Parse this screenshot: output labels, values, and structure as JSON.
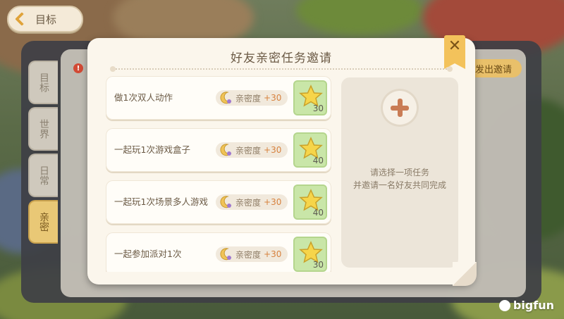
{
  "background": {
    "back_label": "目标",
    "side_tabs": [
      "目标",
      "世界",
      "日常",
      "亲密"
    ],
    "notice_badge": "!",
    "action_button": "发出邀请",
    "watermark": "bigfun"
  },
  "dialog": {
    "title": "好友亲密任务邀请",
    "close_icon": "close-icon",
    "tasks": [
      {
        "name": "做1次双人动作",
        "intimacy_label": "亲密度",
        "intimacy_value": "+30",
        "reward_icon": "star-icon",
        "reward_count": "30"
      },
      {
        "name": "一起玩1次游戏盒子",
        "intimacy_label": "亲密度",
        "intimacy_value": "+30",
        "reward_icon": "star-icon",
        "reward_count": "40"
      },
      {
        "name": "一起玩1次场景多人游戏",
        "intimacy_label": "亲密度",
        "intimacy_value": "+30",
        "reward_icon": "star-icon",
        "reward_count": "40"
      },
      {
        "name": "一起参加派对1次",
        "intimacy_label": "亲密度",
        "intimacy_value": "+30",
        "reward_icon": "star-icon",
        "reward_count": "30"
      }
    ],
    "slot": {
      "icon": "plus-icon",
      "hint_line1": "请选择一项任务",
      "hint_line2": "并邀请一名好友共同完成"
    }
  },
  "colors": {
    "dialog_bg": "#fbf6ec",
    "accent_gold": "#f3c25b",
    "reward_green": "#c9e6a8",
    "intimacy_orange": "#d7823e"
  }
}
